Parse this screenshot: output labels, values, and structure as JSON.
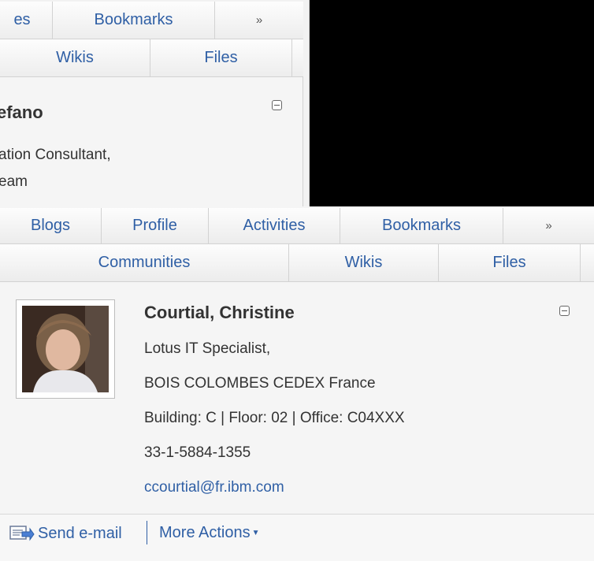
{
  "back_card": {
    "tabs_row1": [
      "es",
      "Bookmarks"
    ],
    "tabs_row2": [
      "Wikis",
      "Files"
    ],
    "name": "efano",
    "lines": [
      "ation Consultant,",
      "eam"
    ]
  },
  "card": {
    "tabs_row1": [
      "Blogs",
      "Profile",
      "Activities",
      "Bookmarks"
    ],
    "tabs_row2": [
      "Communities",
      "Wikis",
      "Files"
    ],
    "more_tabs_icon": "double-chevron-down-icon",
    "collapse_icon": "minus-box-icon",
    "profile": {
      "name": "Courtial, Christine",
      "title": "Lotus IT Specialist,",
      "location": "BOIS COLOMBES CEDEX France",
      "office": "Building: C | Floor: 02 | Office: C04XXX",
      "phone": "33-1-5884-1355",
      "email": "ccourtial@fr.ibm.com"
    },
    "actions": {
      "send_email": "Send e-mail",
      "more_actions": "More Actions"
    }
  },
  "colors": {
    "link": "#2f5fa5",
    "text": "#333333",
    "panel": "#f5f5f5"
  }
}
